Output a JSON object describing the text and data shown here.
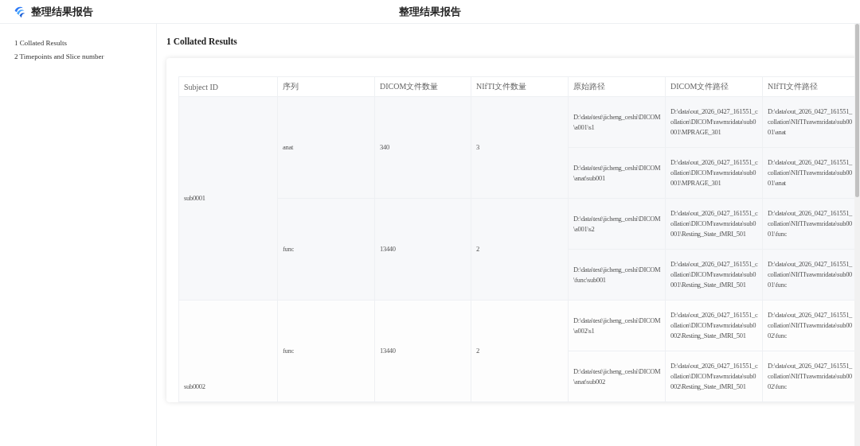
{
  "header": {
    "brand": "整理结果报告",
    "title": "整理结果报告"
  },
  "sidebar": {
    "items": [
      {
        "label": "1 Collated Results",
        "selected": false
      },
      {
        "label": "2 Timepoints and Slice number",
        "selected": false
      }
    ]
  },
  "section": {
    "title": "1 Collated Results"
  },
  "table": {
    "columns": [
      "Subject ID",
      "序列",
      "DICOM文件数量",
      "NIfTI文件数量",
      "原始路径",
      "DICOM文件路径",
      "NIfTI文件路径"
    ],
    "subjects": [
      {
        "id": "sub0001",
        "sequences": [
          {
            "name": "anat",
            "dicom_count": "340",
            "nifti_count": "3",
            "paths": [
              {
                "source": "D:\\data\\test\\jicheng_ceshi\\DICOM\\a001\\s1",
                "dicom": "D:\\data\\out_2026_0427_161551_collation\\DICOM\\rawmridata\\sub0001\\MPRAGE_301",
                "nifti": "D:\\data\\out_2026_0427_161551_collation\\NIfTI\\rawmridata\\sub0001\\anat"
              },
              {
                "source": "D:\\data\\test\\jicheng_ceshi\\DICOM\\anat\\sub001",
                "dicom": "D:\\data\\out_2026_0427_161551_collation\\DICOM\\rawmridata\\sub0001\\MPRAGE_301",
                "nifti": "D:\\data\\out_2026_0427_161551_collation\\NIfTI\\rawmridata\\sub0001\\anat"
              }
            ]
          },
          {
            "name": "func",
            "dicom_count": "13440",
            "nifti_count": "2",
            "paths": [
              {
                "source": "D:\\data\\test\\jicheng_ceshi\\DICOM\\a001\\s2",
                "dicom": "D:\\data\\out_2026_0427_161551_collation\\DICOM\\rawmridata\\sub0001\\Resting_State_fMRI_501",
                "nifti": "D:\\data\\out_2026_0427_161551_collation\\NIfTI\\rawmridata\\sub0001\\func"
              },
              {
                "source": "D:\\data\\test\\jicheng_ceshi\\DICOM\\func\\sub001",
                "dicom": "D:\\data\\out_2026_0427_161551_collation\\DICOM\\rawmridata\\sub0001\\Resting_State_fMRI_501",
                "nifti": "D:\\data\\out_2026_0427_161551_collation\\NIfTI\\rawmridata\\sub0001\\func"
              }
            ]
          }
        ]
      },
      {
        "id": "sub0002",
        "sequences": [
          {
            "name": "func",
            "dicom_count": "13440",
            "nifti_count": "2",
            "paths": [
              {
                "source": "D:\\data\\test\\jicheng_ceshi\\DICOM\\a002\\s1",
                "dicom": "D:\\data\\out_2026_0427_161551_collation\\DICOM\\rawmridata\\sub0002\\Resting_State_fMRI_501",
                "nifti": "D:\\data\\out_2026_0427_161551_collation\\NIfTI\\rawmridata\\sub0002\\func"
              },
              {
                "source": "D:\\data\\test\\jicheng_ceshi\\DICOM\\anat\\sub002",
                "dicom": "D:\\data\\out_2026_0427_161551_collation\\DICOM\\rawmridata\\sub0002\\Resting_State_fMRI_501",
                "nifti": "D:\\data\\out_2026_0427_161551_collation\\NIfTI\\rawmridata\\sub0002\\func"
              }
            ]
          }
        ]
      }
    ]
  }
}
